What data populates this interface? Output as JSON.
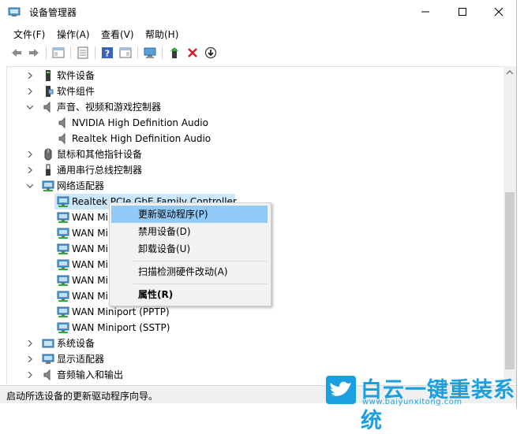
{
  "window": {
    "title": "设备管理器"
  },
  "menu": [
    "文件(F)",
    "操作(A)",
    "查看(V)",
    "帮助(H)"
  ],
  "tree": {
    "items": [
      {
        "label": "软件设备",
        "expanded": false,
        "icon": "software-device-icon"
      },
      {
        "label": "软件组件",
        "expanded": false,
        "icon": "software-component-icon"
      },
      {
        "label": "声音、视频和游戏控制器",
        "expanded": true,
        "icon": "speaker-icon"
      },
      {
        "label": "NVIDIA High Definition Audio",
        "child": true,
        "icon": "speaker-icon"
      },
      {
        "label": "Realtek High Definition Audio",
        "child": true,
        "icon": "speaker-icon"
      },
      {
        "label": "鼠标和其他指针设备",
        "expanded": false,
        "icon": "mouse-icon"
      },
      {
        "label": "通用串行总线控制器",
        "expanded": false,
        "icon": "usb-icon"
      },
      {
        "label": "网络适配器",
        "expanded": true,
        "icon": "network-icon"
      },
      {
        "label": "Realtek PCIe GbE Family Controller",
        "child": true,
        "selected": true,
        "icon": "network-icon"
      },
      {
        "label": "WAN Mi",
        "child": true,
        "icon": "network-icon"
      },
      {
        "label": "WAN Mi",
        "child": true,
        "icon": "network-icon"
      },
      {
        "label": "WAN Mi",
        "child": true,
        "icon": "network-icon"
      },
      {
        "label": "WAN Mi",
        "child": true,
        "icon": "network-icon"
      },
      {
        "label": "WAN Mi",
        "child": true,
        "icon": "network-icon"
      },
      {
        "label": "WAN Mi",
        "child": true,
        "icon": "network-icon"
      },
      {
        "label": "WAN Miniport (PPTP)",
        "child": true,
        "icon": "network-icon"
      },
      {
        "label": "WAN Miniport (SSTP)",
        "child": true,
        "icon": "network-icon"
      },
      {
        "label": "系统设备",
        "expanded": false,
        "icon": "system-icon"
      },
      {
        "label": "显示适配器",
        "expanded": false,
        "icon": "monitor-icon"
      },
      {
        "label": "音频输入和输出",
        "expanded": false,
        "icon": "speaker-icon"
      }
    ]
  },
  "context_menu": {
    "update_driver": "更新驱动程序(P)",
    "disable_device": "禁用设备(D)",
    "uninstall_device": "卸载设备(U)",
    "scan_hardware": "扫描检测硬件改动(A)",
    "properties": "属性(R)"
  },
  "status": {
    "text": "启动所选设备的更新驱动程序向导。"
  },
  "watermark": {
    "brand": "白云一键重装系统",
    "url": "www.baiyunxitong.com"
  },
  "colors": {
    "accent": "#1a9fe0",
    "selection": "#cce8ff",
    "menu_highlight": "#91c9f7"
  }
}
